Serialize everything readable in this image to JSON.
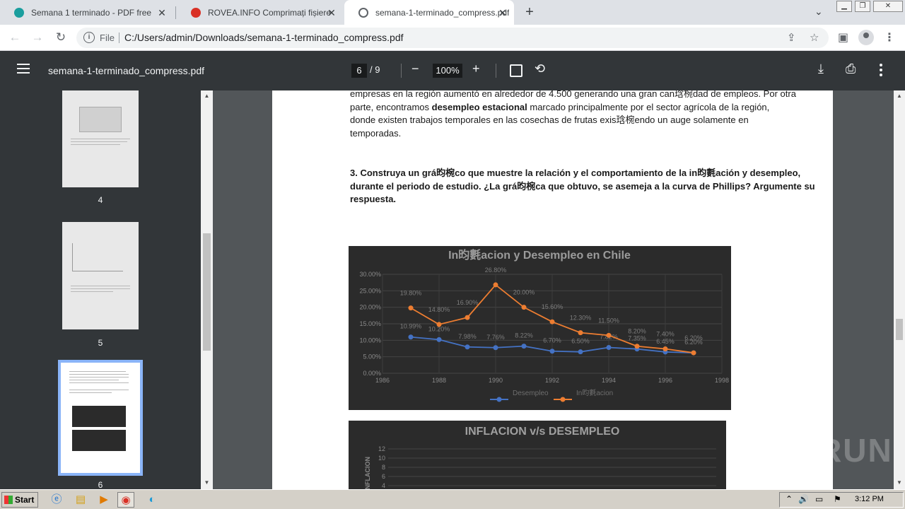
{
  "tabs": [
    {
      "label": "Semana 1 terminado - PDF free",
      "color": "#1a9e9e"
    },
    {
      "label": "ROVEA.INFO Comprimați fișiere PDF",
      "color": "#d93025"
    },
    {
      "label": "semana-1-terminado_compress.pdf",
      "color": "#5f6368"
    }
  ],
  "toolbar": {
    "file_label": "File",
    "url": "C:/Users/admin/Downloads/semana-1-terminado_compress.pdf"
  },
  "pdf": {
    "title": "semana-1-terminado_compress.pdf",
    "page_current": "6",
    "page_total": "/  9",
    "zoom": "100%"
  },
  "thumbnails": [
    {
      "label": "4"
    },
    {
      "label": "5"
    },
    {
      "label": "6"
    }
  ],
  "page": {
    "line1": "empresas en la región aumentó en alrededor de 4.500 generando una gran can琀椀dad de empleos. Por otra",
    "line2_pre": "parte, encontramos ",
    "line2_bold": "desempleo estacional",
    "line2_post": " marcado principalmente por el sector agrícola de la región,",
    "line3": "donde existen trabajos temporales en las cosechas de frutas exis琀椀endo un auge solamente en",
    "line4": "temporadas.",
    "q1": "3. Construya un grá昀椀co que muestre la relación y el comportamiento de la in昀氀ación y desempleo,",
    "q2": "durante el periodo de estudio. ¿La grá昀椀ca que obtuvo, se asemeja a la curva de Phillips? Argumente su",
    "q3": "respuesta."
  },
  "chart_data": [
    {
      "type": "line",
      "title": "In昀氀acion y Desempleo en Chile",
      "x": [
        1987,
        1988,
        1989,
        1990,
        1991,
        1992,
        1993,
        1994,
        1995,
        1996,
        1997
      ],
      "series": [
        {
          "name": "Desempleo",
          "color": "#4472c4",
          "values": [
            10.99,
            10.2,
            7.98,
            7.76,
            8.22,
            6.7,
            6.5,
            7.82,
            7.35,
            6.45,
            6.2
          ]
        },
        {
          "name": "In昀氀acion",
          "color": "#ed7d31",
          "values": [
            19.8,
            14.8,
            16.9,
            26.8,
            20.0,
            15.6,
            12.3,
            11.5,
            8.2,
            7.4,
            6.2
          ]
        }
      ],
      "ylim": [
        0,
        30
      ],
      "yticks": [
        "0.00%",
        "5.00%",
        "10.00%",
        "15.00%",
        "20.00%",
        "25.00%",
        "30.00%"
      ],
      "xticks": [
        "1986",
        "1988",
        "1990",
        "1992",
        "1994",
        "1996",
        "1998"
      ],
      "xlim": [
        1986,
        1998
      ]
    },
    {
      "type": "line",
      "title": "INFLACION v/s DESEMPLEO",
      "ylabel": "INFLACION",
      "yticks": [
        "4",
        "6",
        "8",
        "10",
        "12"
      ]
    }
  ],
  "taskbar": {
    "start": "Start",
    "clock": "3:12 PM"
  },
  "watermark": "ANY RUN"
}
